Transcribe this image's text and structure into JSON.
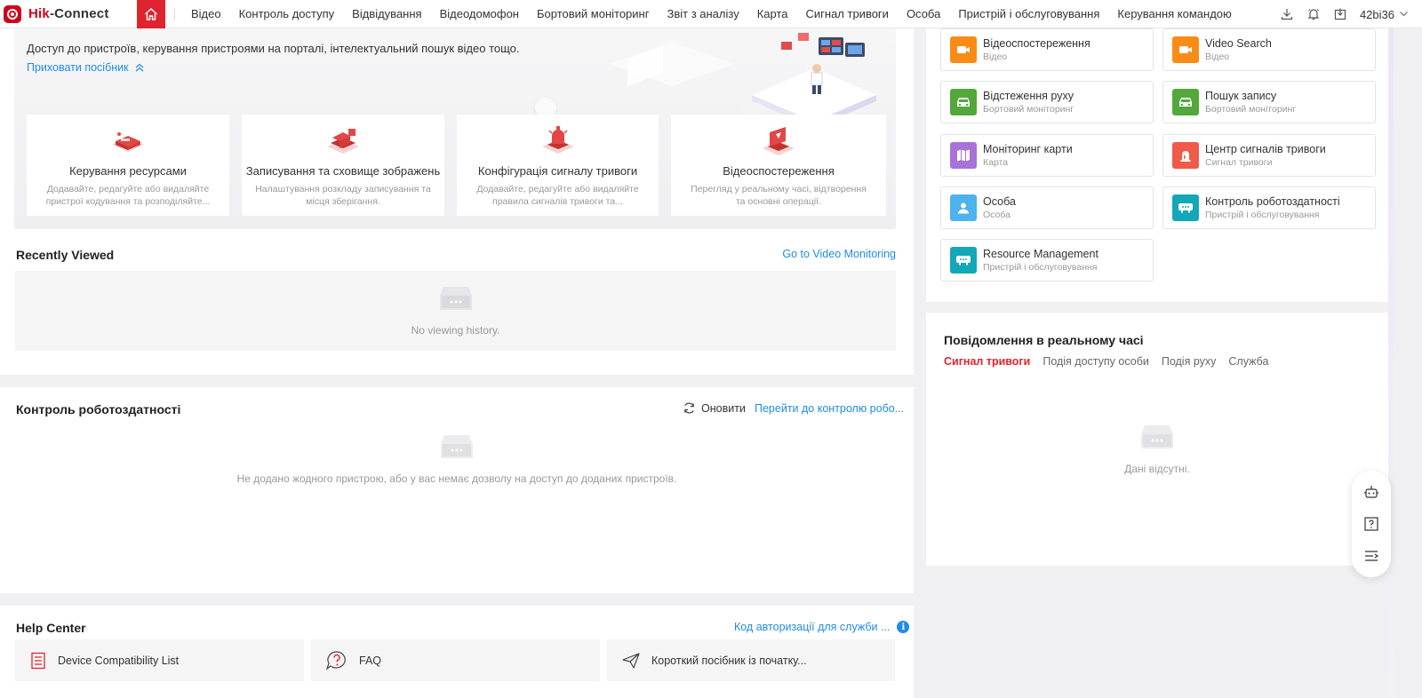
{
  "app": {
    "brand_red": "Hik",
    "brand_dark": "-Connect",
    "accent": "#e0242f",
    "link_color": "#1f8ce6"
  },
  "nav": {
    "items": [
      "Відео",
      "Контроль доступу",
      "Відвідування",
      "Відеодомофон",
      "Бортовий моніторинг",
      "Звіт з аналізу",
      "Карта",
      "Сигнал тривоги",
      "Особа",
      "Пристрій і обслуговування",
      "Керування командою"
    ],
    "user": "42bi36"
  },
  "guide": {
    "description": "Доступ до пристроїв, керування пристроями на порталі, інтелектуальний пошук відео тощо.",
    "hide_label": "Приховати посібник",
    "tiles": [
      {
        "title": "Керування ресурсами",
        "desc": "Додавайте, редагуйте або видаляйте пристрої кодування та розподіляйте..."
      },
      {
        "title": "Записування та сховище зображень",
        "desc": "Налаштування розкладу записування та місця зберігання."
      },
      {
        "title": "Конфігурація сигналу тривоги",
        "desc": "Додавайте, редагуйте або видаляйте правила сигналів тривоги та..."
      },
      {
        "title": "Відеоспостереження",
        "desc": "Перегляд у реальному часі, відтворення та основні операції."
      }
    ]
  },
  "recently_viewed": {
    "title": "Recently Viewed",
    "link": "Go to Video Monitoring",
    "empty": "No viewing history."
  },
  "health": {
    "title": "Контроль роботоздатності",
    "refresh": "Оновити",
    "link": "Перейти до контролю робо...",
    "empty": "Не додано жодного пристрою, або у вас немає дозволу на доступ до доданих пристроїв."
  },
  "help": {
    "title": "Help Center",
    "link": "Код авторизації для служби ...",
    "items": [
      "Device Compatibility List",
      "FAQ",
      "Короткий посібник із початку..."
    ]
  },
  "apps": [
    {
      "name": "Відеоспостереження",
      "sub": "Відео",
      "color": "#fa8c16",
      "icon": "video-camera-icon"
    },
    {
      "name": "Video Search",
      "sub": "Відео",
      "color": "#fa8c16",
      "icon": "video-search-icon"
    },
    {
      "name": "Відстеження руху",
      "sub": "Бортовий моніторинг",
      "color": "#52a83a",
      "icon": "vehicle-icon"
    },
    {
      "name": "Пошук запису",
      "sub": "Бортовий моніторинг",
      "color": "#52a83a",
      "icon": "vehicle-icon"
    },
    {
      "name": "Моніторинг карти",
      "sub": "Карта",
      "color": "#a872d8",
      "icon": "map-icon"
    },
    {
      "name": "Центр сигналів тривоги",
      "sub": "Сигнал тривоги",
      "color": "#f05a48",
      "icon": "alarm-icon"
    },
    {
      "name": "Особа",
      "sub": "Особа",
      "color": "#4db2ee",
      "icon": "person-icon"
    },
    {
      "name": "Контроль роботоздатності",
      "sub": "Пристрій і обслуговування",
      "color": "#13a8b8",
      "icon": "device-icon"
    },
    {
      "name": "Resource Management",
      "sub": "Пристрій і обслуговування",
      "color": "#13a8b8",
      "icon": "device-icon"
    }
  ],
  "realtime": {
    "title": "Повідомлення в реальному часі",
    "tabs": [
      "Сигнал тривоги",
      "Подія доступу особи",
      "Подія руху",
      "Служба"
    ],
    "empty": "Дані відсутні."
  }
}
